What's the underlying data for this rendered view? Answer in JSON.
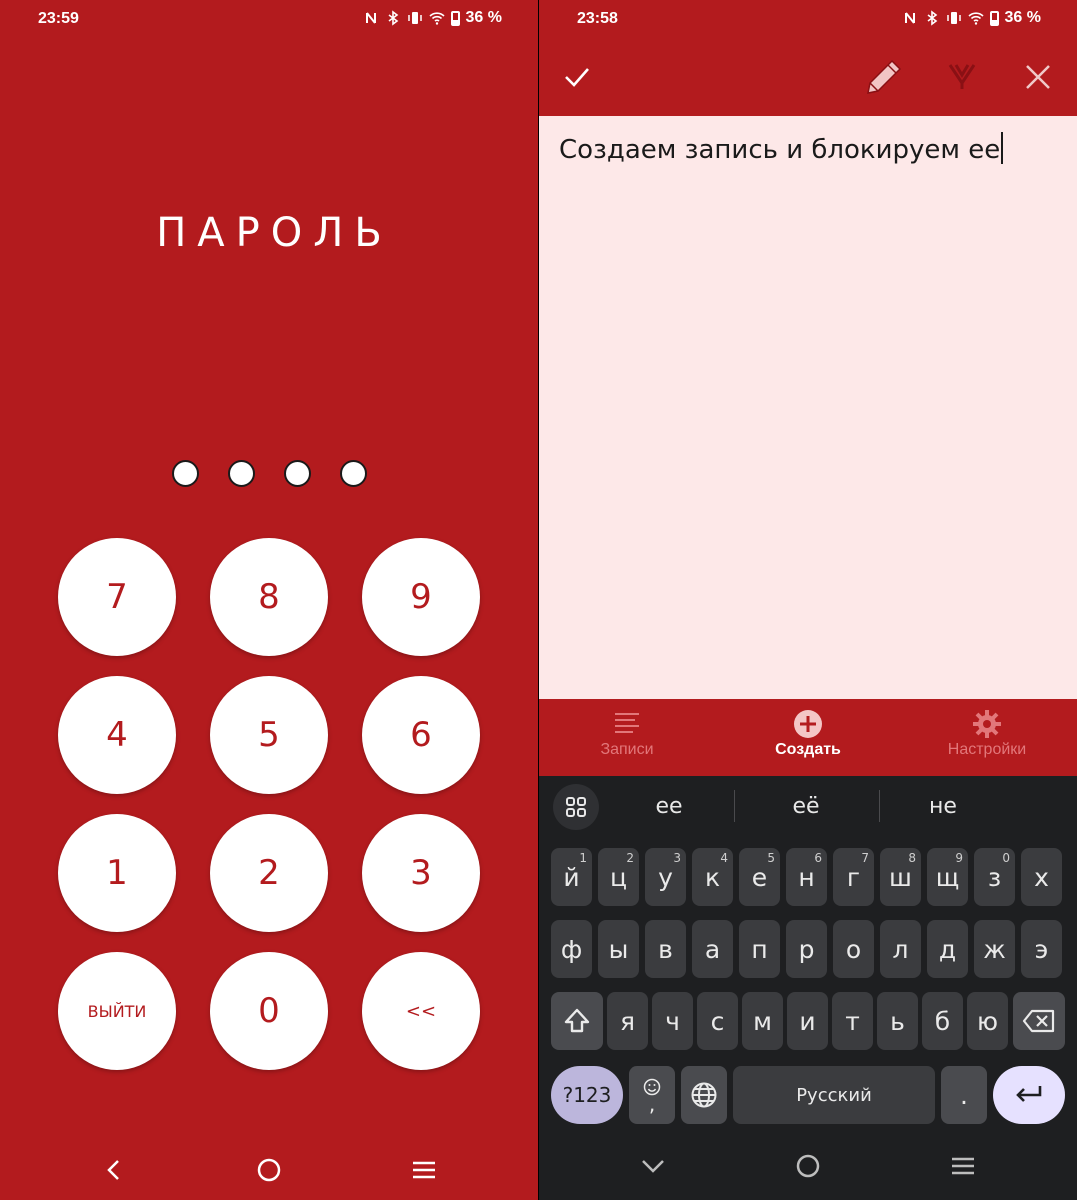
{
  "left": {
    "status": {
      "time": "23:59",
      "battery": "36 %"
    },
    "title": "ПАРОЛЬ",
    "keys": {
      "k7": "7",
      "k8": "8",
      "k9": "9",
      "k4": "4",
      "k5": "5",
      "k6": "6",
      "k1": "1",
      "k2": "2",
      "k3": "3",
      "exit": "ВЫЙТИ",
      "k0": "0",
      "back": "<<"
    }
  },
  "right": {
    "status": {
      "time": "23:58",
      "battery": "36 %"
    },
    "editor_text": "Создаем запись и блокируем ее",
    "tabs": {
      "notes": "Записи",
      "create": "Создать",
      "settings": "Настройки"
    },
    "suggestions": [
      "ее",
      "её",
      "не"
    ],
    "keyboard": {
      "row1": [
        "й",
        "ц",
        "у",
        "к",
        "е",
        "н",
        "г",
        "ш",
        "щ",
        "з",
        "х"
      ],
      "row1_hints": [
        "1",
        "2",
        "3",
        "4",
        "5",
        "6",
        "7",
        "8",
        "9",
        "0",
        ""
      ],
      "row2": [
        "ф",
        "ы",
        "в",
        "а",
        "п",
        "р",
        "о",
        "л",
        "д",
        "ж",
        "э"
      ],
      "row3": [
        "я",
        "ч",
        "с",
        "м",
        "и",
        "т",
        "ь",
        "б",
        "ю"
      ],
      "symbols": "?123",
      "emoji_comma": ",",
      "space": "Русский",
      "period": "."
    }
  },
  "colors": {
    "brand_red": "#b31b1e",
    "editor_bg": "#fde8e8",
    "keyboard_bg": "#1e1f21"
  }
}
